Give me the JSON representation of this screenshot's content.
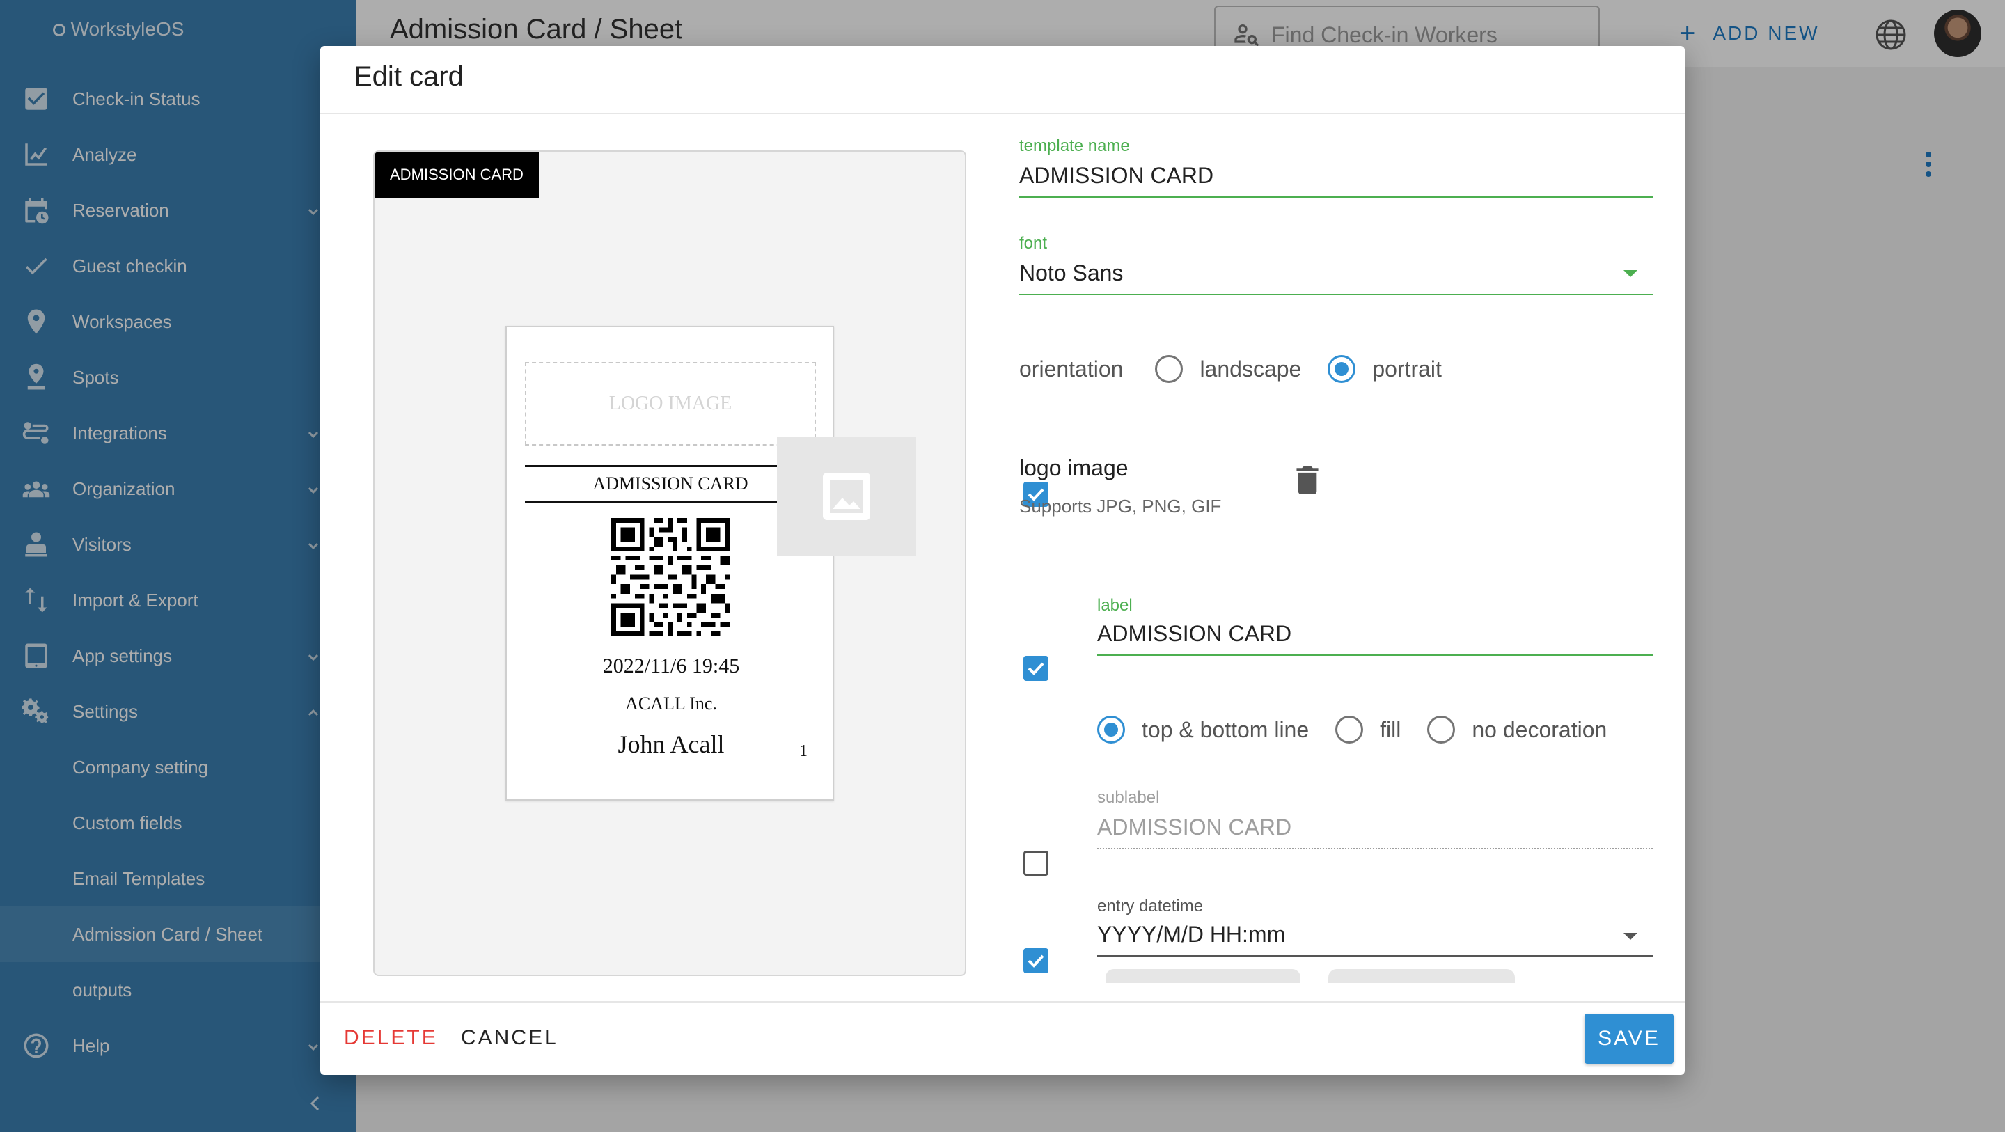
{
  "app": {
    "brand": "WorkstyleOS"
  },
  "sidebar": {
    "items": [
      {
        "label": "Check-in Status",
        "icon": "checkbox-icon"
      },
      {
        "label": "Analyze",
        "icon": "line-chart-icon"
      },
      {
        "label": "Reservation",
        "icon": "calendar-clock-icon"
      },
      {
        "label": "Guest checkin",
        "icon": "check-icon"
      },
      {
        "label": "Workspaces",
        "icon": "location-pin-icon"
      },
      {
        "label": "Spots",
        "icon": "spot-pin-icon"
      },
      {
        "label": "Integrations",
        "icon": "integrations-icon"
      },
      {
        "label": "Organization",
        "icon": "people-icon"
      },
      {
        "label": "Visitors",
        "icon": "visitor-icon"
      },
      {
        "label": "Import & Export",
        "icon": "import-export-icon"
      },
      {
        "label": "App settings",
        "icon": "tablet-icon"
      },
      {
        "label": "Settings",
        "icon": "gears-icon"
      },
      {
        "label": "Company setting"
      },
      {
        "label": "Custom fields"
      },
      {
        "label": "Email Templates"
      },
      {
        "label": "Admission Card / Sheet"
      },
      {
        "label": "outputs"
      },
      {
        "label": "Help",
        "icon": "help-icon"
      }
    ]
  },
  "header": {
    "title": "Admission Card / Sheet",
    "search_placeholder": "Find Check-in Workers",
    "add_new": "ADD NEW"
  },
  "dialog": {
    "title": "Edit card",
    "preview": {
      "tag": "ADMISSION CARD",
      "logo_placeholder": "LOGO IMAGE",
      "label": "ADMISSION CARD",
      "datetime": "2022/11/6 19:45",
      "company": "ACALL Inc.",
      "name": "John Acall",
      "number": "1"
    },
    "template_name": {
      "label": "template name",
      "value": "ADMISSION CARD"
    },
    "font": {
      "label": "font",
      "value": "Noto Sans"
    },
    "orientation": {
      "label": "orientation",
      "options": [
        "landscape",
        "portrait"
      ],
      "selected": "portrait"
    },
    "logo_image": {
      "enabled": true,
      "title": "logo image",
      "hint": "Supports JPG, PNG, GIF"
    },
    "label_field": {
      "enabled": true,
      "label": "label",
      "value": "ADMISSION CARD",
      "decoration_options": [
        "top & bottom line",
        "fill",
        "no decoration"
      ],
      "decoration_selected": "top & bottom line"
    },
    "sublabel": {
      "enabled": false,
      "label": "sublabel",
      "value": "ADMISSION CARD"
    },
    "entry_datetime": {
      "enabled": true,
      "label": "entry datetime",
      "value": "YYYY/M/D HH:mm"
    },
    "buttons": {
      "delete": "DELETE",
      "cancel": "CANCEL",
      "save": "SAVE"
    }
  },
  "colors": {
    "sidebar": "#3b7fb1",
    "accent": "#2f8fd3",
    "field_focus": "#4caf50",
    "danger": "#e53935"
  }
}
